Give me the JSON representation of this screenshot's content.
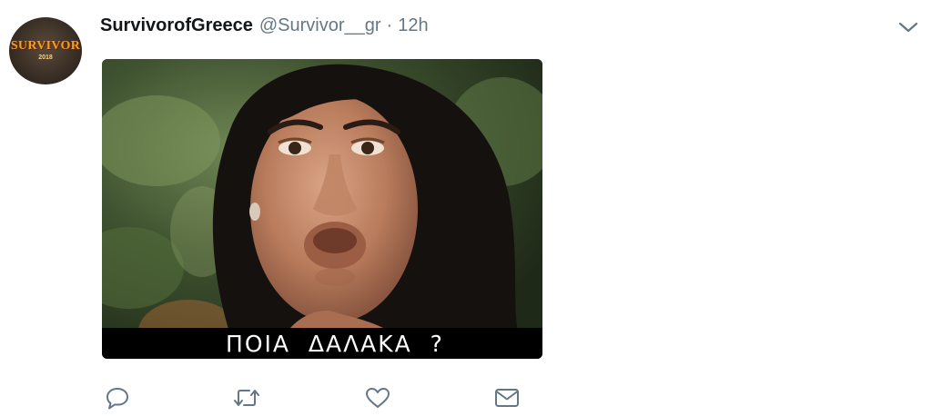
{
  "tweet": {
    "display_name": "SurvivorofGreece",
    "handle": "@Survivor__gr",
    "separator": "·",
    "time": "12h",
    "avatar": {
      "logo_text": "SURVIVOR",
      "logo_year": "2018"
    },
    "media": {
      "subtitle": "ΠΟΙΑ  ΔΑΛΑΚΑ  ?"
    },
    "actions": {
      "reply_icon": "reply-icon",
      "retweet_icon": "retweet-icon",
      "like_icon": "heart-icon",
      "message_icon": "envelope-icon"
    },
    "menu_icon": "chevron-down-icon"
  },
  "colors": {
    "name": "#14171a",
    "secondary": "#657786",
    "icon": "#657786",
    "background": "#ffffff"
  }
}
